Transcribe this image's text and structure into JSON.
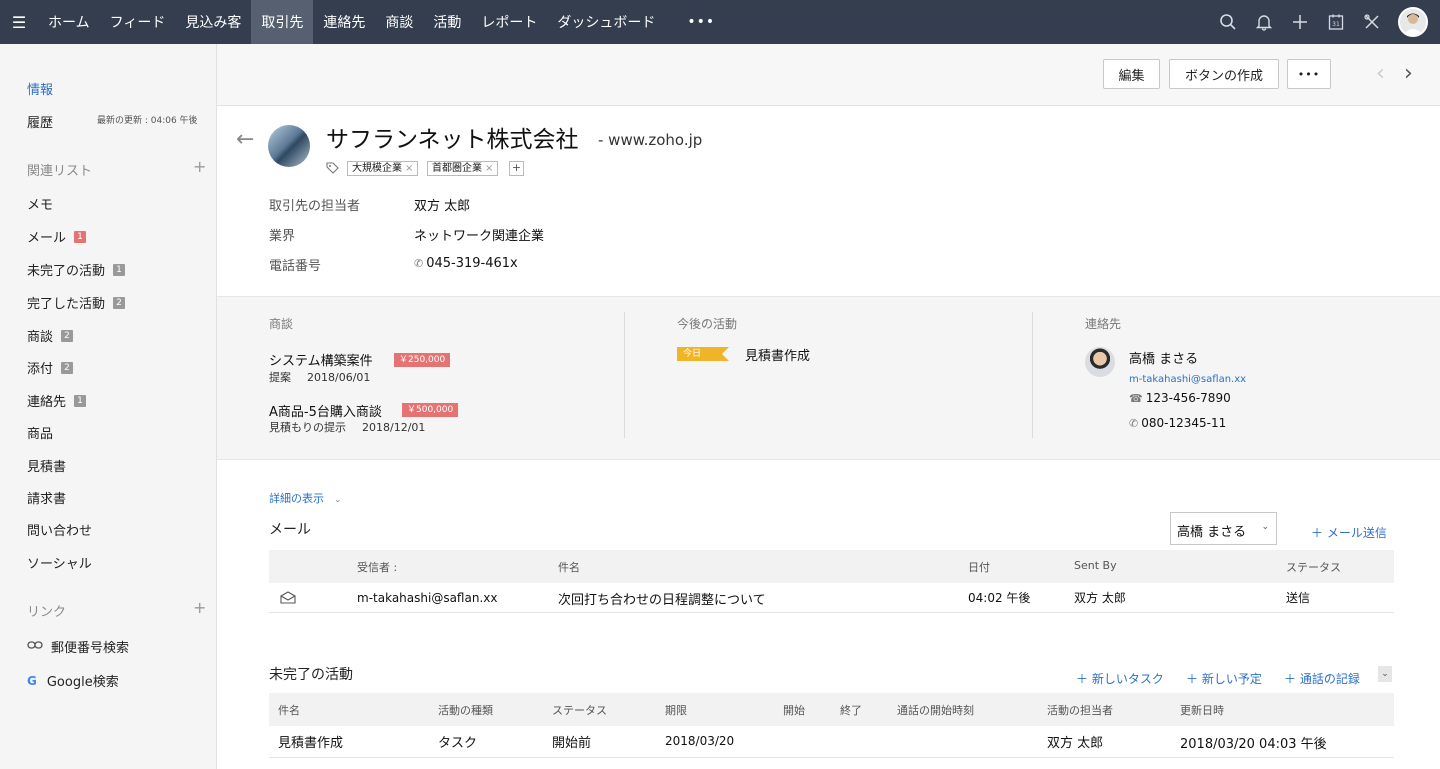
{
  "nav": {
    "items": [
      "ホーム",
      "フィード",
      "見込み客",
      "取引先",
      "連絡先",
      "商談",
      "活動",
      "レポート",
      "ダッシュボード"
    ],
    "active_index": 3,
    "more": "•••",
    "icons": [
      "search-icon",
      "bell-icon",
      "plus-icon",
      "calendar-icon",
      "tools-icon"
    ],
    "calendar_day": "31"
  },
  "sidebar": {
    "info": "情報",
    "history": "履歴",
    "last_updated": "最新の更新 : 04:06 午後",
    "related_list_title": "関連リスト",
    "related": [
      {
        "label": "メモ",
        "count": ""
      },
      {
        "label": "メール",
        "count": "1"
      },
      {
        "label": "未完了の活動",
        "count": "1"
      },
      {
        "label": "完了した活動",
        "count": "2"
      },
      {
        "label": "商談",
        "count": "2"
      },
      {
        "label": "添付",
        "count": "2"
      },
      {
        "label": "連絡先",
        "count": "1"
      },
      {
        "label": "商品",
        "count": ""
      },
      {
        "label": "見積書",
        "count": ""
      },
      {
        "label": "請求書",
        "count": ""
      },
      {
        "label": "問い合わせ",
        "count": ""
      },
      {
        "label": "ソーシャル",
        "count": ""
      }
    ],
    "links_title": "リンク",
    "links": [
      {
        "label": "郵便番号検索",
        "icon": "link-icon"
      },
      {
        "label": "Google検索",
        "icon": "google-icon"
      }
    ]
  },
  "actions": {
    "edit": "編集",
    "create_button": "ボタンの作成",
    "more": "•••"
  },
  "account": {
    "name": "サフランネット株式会社",
    "website": "- www.zoho.jp",
    "tags": [
      "大規模企業",
      "首都圏企業"
    ],
    "fields": [
      {
        "label": "取引先の担当者",
        "value": "双方 太郎"
      },
      {
        "label": "業界",
        "value": "ネットワーク関連企業"
      },
      {
        "label": "電話番号",
        "value": "045-319-461x"
      }
    ]
  },
  "summary": {
    "deals_title": "商談",
    "deals": [
      {
        "name": "システム構築案件",
        "amount": "￥250,000",
        "stage": "提案",
        "date": "2018/06/01"
      },
      {
        "name": "A商品-5台購入商談",
        "amount": "￥500,000",
        "stage": "見積もりの提示",
        "date": "2018/12/01"
      }
    ],
    "activities_title": "今後の活動",
    "activity_badge": "今日",
    "activity": "見積書作成",
    "contacts_title": "連絡先",
    "contact": {
      "name": "高橋 まさる",
      "email": "m-takahashi@saflan.xx",
      "phone": "123-456-7890",
      "mobile": "080-12345-11"
    }
  },
  "details_link": "詳細の表示",
  "mail": {
    "title": "メール",
    "selected_contact": "高橋 まさる",
    "send_action": "＋ メール送信",
    "columns": [
      "受信者 :",
      "件名",
      "日付",
      "Sent By",
      "ステータス"
    ],
    "rows": [
      {
        "to": "m-takahashi@saflan.xx",
        "subject": "次回打ち合わせの日程調整について",
        "date": "04:02 午後",
        "sent_by": "双方 太郎",
        "status": "送信"
      }
    ]
  },
  "open_activities": {
    "title": "未完了の活動",
    "actions": [
      "＋ 新しいタスク",
      "＋ 新しい予定",
      "＋ 通話の記録"
    ],
    "columns": [
      "件名",
      "活動の種類",
      "ステータス",
      "期限",
      "開始",
      "終了",
      "通話の開始時刻",
      "活動の担当者",
      "更新日時"
    ],
    "rows": [
      {
        "subject": "見積書作成",
        "type": "タスク",
        "status": "開始前",
        "due": "2018/03/20",
        "start": "",
        "end": "",
        "call_start": "",
        "owner": "双方 太郎",
        "modified": "2018/03/20 04:03 午後"
      }
    ]
  }
}
